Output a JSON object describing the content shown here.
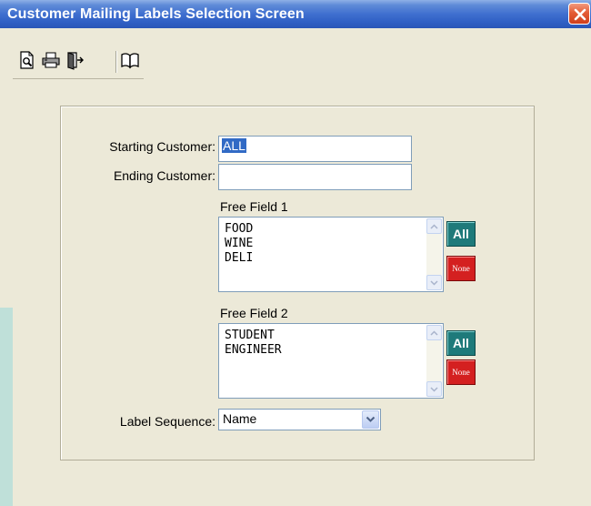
{
  "window": {
    "title": "Customer Mailing Labels Selection Screen"
  },
  "toolbar": {
    "buttons": [
      "print-preview-icon",
      "printer-icon",
      "exit-door-icon",
      "open-book-icon"
    ]
  },
  "form": {
    "starting_customer": {
      "label": "Starting Customer:",
      "value": "ALL"
    },
    "ending_customer": {
      "label": "Ending Customer:",
      "value": ""
    },
    "free_field_1": {
      "label": "Free Field 1",
      "items": [
        "FOOD",
        "WINE",
        "DELI"
      ]
    },
    "free_field_2": {
      "label": "Free Field 2",
      "items": [
        "STUDENT",
        "ENGINEER"
      ]
    },
    "all_label": "All",
    "none_label": "None",
    "label_sequence": {
      "label": "Label Sequence:",
      "value": "Name"
    }
  },
  "colors": {
    "titlebar": "#3f6fcf",
    "all_button": "#1e7a7a",
    "none_button": "#d42020",
    "selection": "#316ac5"
  }
}
